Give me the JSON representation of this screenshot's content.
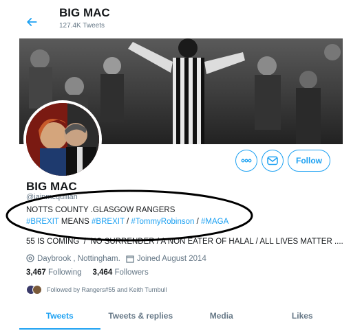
{
  "header": {
    "name": "BIG MAC",
    "tweet_count": "127.4K Tweets"
  },
  "profile": {
    "display_name": "BIG MAC",
    "handle": "@iainmcquillan",
    "bio_line1": "NOTTS COUNTY .GLASGOW RANGERS",
    "bio_line2": {
      "tag1": "#BREXIT",
      "text1": " MEANS ",
      "tag2": "#BREXIT",
      "text2": " / ",
      "tag3": "#TommyRobinson",
      "text3": " / ",
      "tag4": "#MAGA"
    },
    "bio_line3": "55 IS COMING  /  NO SURRENDER / A NON EATER OF HALAL / ALL LIVES MATTER ....",
    "location": "Daybrook , Nottingham.",
    "joined": "Joined August 2014",
    "following_count": "3,467",
    "following_label": "Following",
    "followers_count": "3,464",
    "followers_label": "Followers",
    "followed_by": "Followed by Rangers#55 and Keith Turnbull"
  },
  "actions": {
    "more_label": "ooo",
    "follow_label": "Follow"
  },
  "tabs": [
    {
      "label": "Tweets",
      "active": true
    },
    {
      "label": "Tweets & replies",
      "active": false
    },
    {
      "label": "Media",
      "active": false
    },
    {
      "label": "Likes",
      "active": false
    }
  ],
  "colors": {
    "accent": "#1da1f2",
    "text": "#14171a",
    "muted": "#657786"
  },
  "icons": [
    "back-arrow-icon",
    "more-icon",
    "message-icon",
    "location-icon",
    "calendar-icon"
  ]
}
